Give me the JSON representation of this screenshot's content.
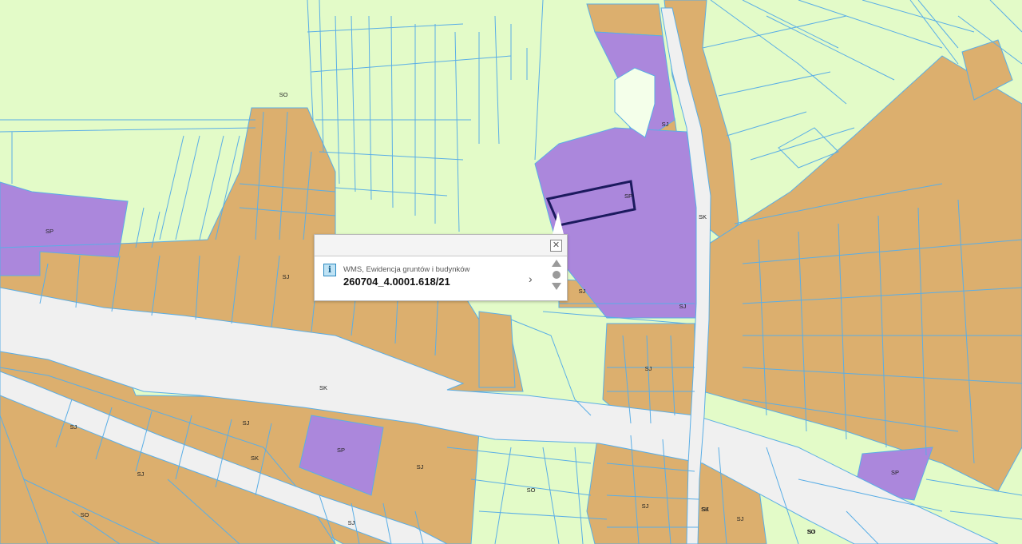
{
  "map": {
    "colors": {
      "background": "#e3fbc8",
      "residential": "#dcaf6e",
      "services": "#ab87dc",
      "road": "#f0f0f0",
      "parcel_line": "#5aaee6",
      "selection": "#1c1a5e"
    },
    "labels": [
      {
        "text": "SO"
      },
      {
        "text": "SP"
      },
      {
        "text": "SJ"
      },
      {
        "text": "SJ"
      },
      {
        "text": "SP"
      },
      {
        "text": "SJ"
      },
      {
        "text": "SK"
      },
      {
        "text": "SJ"
      },
      {
        "text": "SJ"
      },
      {
        "text": "SK"
      },
      {
        "text": "SJ"
      },
      {
        "text": "SJ"
      },
      {
        "text": "SK"
      },
      {
        "text": "SJ"
      },
      {
        "text": "SJ"
      },
      {
        "text": "SP"
      },
      {
        "text": "SJ"
      },
      {
        "text": "SO"
      },
      {
        "text": "SO"
      },
      {
        "text": "SJ"
      },
      {
        "text": "SJ"
      },
      {
        "text": "SJ"
      },
      {
        "text": "SK"
      },
      {
        "text": "SJ"
      },
      {
        "text": "SO"
      },
      {
        "text": "SP"
      },
      {
        "text": "SO"
      }
    ]
  },
  "popup": {
    "layer_name": "WMS, Ewidencja gruntów i budynków",
    "parcel_id": "260704_4.0001.618/21",
    "info_icon_glyph": "i",
    "close_glyph": "✕",
    "next_glyph": "›"
  }
}
